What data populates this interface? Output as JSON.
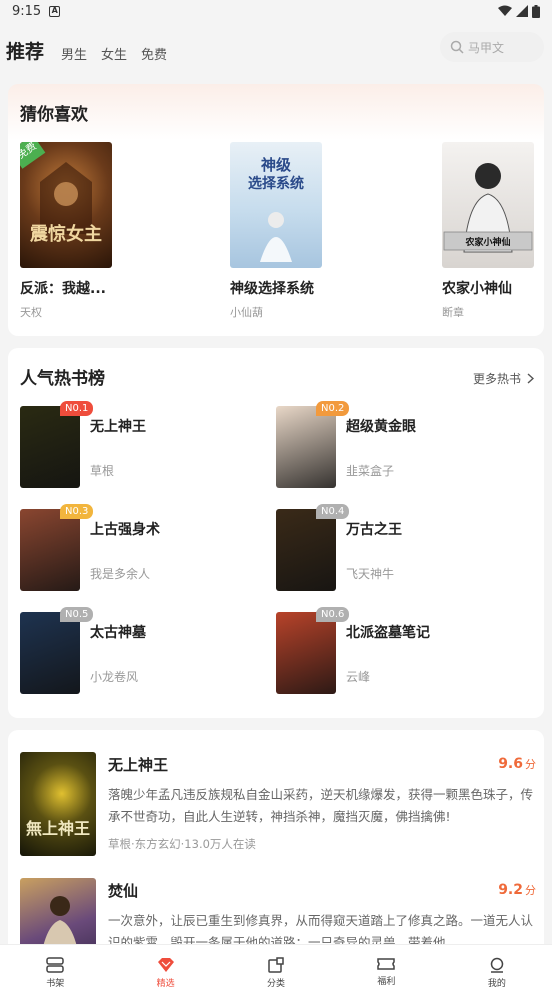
{
  "status": {
    "time": "9:15"
  },
  "tabs": [
    {
      "label": "推荐"
    },
    {
      "label": "男生"
    },
    {
      "label": "女生"
    },
    {
      "label": "免费"
    }
  ],
  "search": {
    "placeholder": "马甲文"
  },
  "guess": {
    "title": "猜你喜欢",
    "free_tag": "免费",
    "items": [
      {
        "title": "反派：我越...",
        "author": "天权",
        "cover_color": "#5a3a1e"
      },
      {
        "title": "神级选择系统",
        "author": "小仙葫",
        "cover_color": "#cfe0ee"
      },
      {
        "title": "农家小神仙",
        "author": "断章",
        "cover_color": "#e8e6e4",
        "cover_caption": "农家小神仙"
      }
    ]
  },
  "ranking": {
    "title": "人气热书榜",
    "more_label": "更多热书",
    "items": [
      {
        "rank": "N0.1",
        "title": "无上神王",
        "author": "草根",
        "badge_color": "#ef4d3c",
        "cover_color": "#2a2a12"
      },
      {
        "rank": "N0.2",
        "title": "超级黄金眼",
        "author": "韭菜盒子",
        "badge_color": "#f29a3d",
        "cover_color": "#e9d8c8"
      },
      {
        "rank": "N0.3",
        "title": "上古强身术",
        "author": "我是多余人",
        "badge_color": "#f2b53d",
        "cover_color": "#8a4630"
      },
      {
        "rank": "N0.4",
        "title": "万古之王",
        "author": "飞天神牛",
        "badge_color": "#b0b0b0",
        "cover_color": "#3a2a18"
      },
      {
        "rank": "N0.5",
        "title": "太古神墓",
        "author": "小龙卷风",
        "badge_color": "#b0b0b0",
        "cover_color": "#1e3350"
      },
      {
        "rank": "N0.6",
        "title": "北派盗墓笔记",
        "author": "云峰",
        "badge_color": "#b0b0b0",
        "cover_color": "#b8432a"
      }
    ]
  },
  "recommend": {
    "items": [
      {
        "title": "无上神王",
        "score": "9.6",
        "score_unit": "分",
        "desc": "落魄少年孟凡违反族规私自金山采药，逆天机缘爆发，获得一颗黑色珠子，传承不世奇功，自此人生逆转，神挡杀神，魔挡灭魔，佛挡擒佛!",
        "meta": "草根·东方玄幻·13.0万人在读",
        "cover_color": "#2a2a12"
      },
      {
        "title": "焚仙",
        "score": "9.2",
        "score_unit": "分",
        "desc": "一次意外，让辰已重生到修真界，从而得窥天道踏上了修真之路。一道无人认识的紫霄，毁开一条属于他的道路；一只奇异的灵兽，带着他",
        "meta": "",
        "cover_color": "#5a4a70"
      }
    ]
  },
  "bottom_nav": [
    {
      "label": "书架",
      "icon": "bookshelf-icon"
    },
    {
      "label": "精选",
      "icon": "diamond-icon",
      "active": true
    },
    {
      "label": "分类",
      "icon": "category-icon"
    },
    {
      "label": "福利",
      "icon": "ticket-icon"
    },
    {
      "label": "我的",
      "icon": "profile-icon"
    }
  ],
  "colors": {
    "accent": "#ef4d3c",
    "score": "#ef6a3a"
  }
}
